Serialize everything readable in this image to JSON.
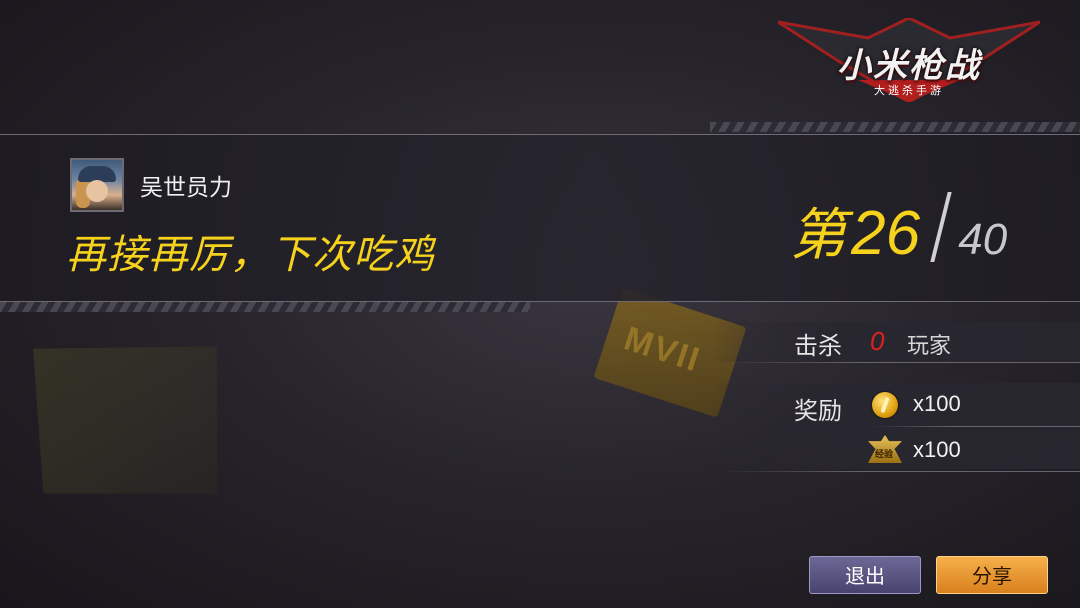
{
  "logo": {
    "title": "小米枪战",
    "subtitle": "大逃杀手游"
  },
  "player": {
    "name": "吴世员力",
    "avatar_icon": "soldier-avatar"
  },
  "result": {
    "slogan": "再接再厉，下次吃鸡",
    "rank_prefix": "第",
    "rank": "26",
    "total": "40"
  },
  "stats": {
    "kills_label": "击杀",
    "kills_value": "0",
    "kills_unit": "玩家",
    "reward_label": "奖励",
    "rewards": [
      {
        "icon": "gold-coin-icon",
        "amount": "x100"
      },
      {
        "icon": "experience-badge-icon",
        "icon_text": "经验",
        "amount": "x100"
      }
    ]
  },
  "buttons": {
    "exit": "退出",
    "share": "分享"
  },
  "colors": {
    "accent_yellow": "#f6d21d",
    "kills_red": "#e02020",
    "share_orange": "#e8962c",
    "exit_purple": "#5a5582"
  }
}
